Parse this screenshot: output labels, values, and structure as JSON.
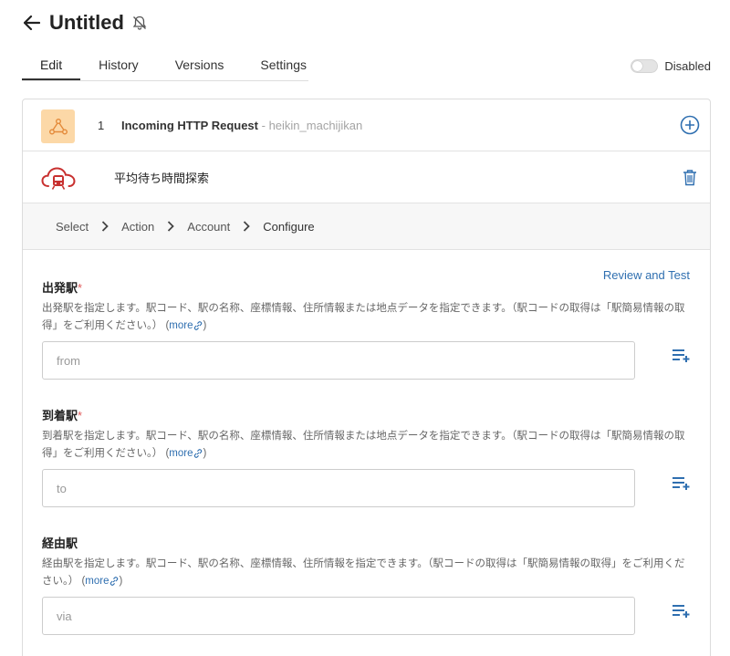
{
  "header": {
    "title": "Untitled"
  },
  "tabs": [
    {
      "label": "Edit",
      "active": true
    },
    {
      "label": "History"
    },
    {
      "label": "Versions"
    },
    {
      "label": "Settings"
    }
  ],
  "toggle": {
    "label": "Disabled",
    "enabled": false
  },
  "step": {
    "number": "1",
    "title": "Incoming HTTP Request",
    "subtitle": "- heikin_machijikan"
  },
  "service": {
    "title": "平均待ち時間探索"
  },
  "breadcrumb": {
    "items": [
      "Select",
      "Action",
      "Account",
      "Configure"
    ]
  },
  "form": {
    "review_label": "Review and Test",
    "more_label": "more",
    "fields": [
      {
        "label": "出発駅",
        "required": "*",
        "description": "出発駅を指定します。駅コード、駅の名称、座標情報、住所情報または地点データを指定できます。（駅コードの取得は「駅簡易情報の取得」をご利用ください。）",
        "placeholder": "from"
      },
      {
        "label": "到着駅",
        "required": "*",
        "description": "到着駅を指定します。駅コード、駅の名称、座標情報、住所情報または地点データを指定できます。（駅コードの取得は「駅簡易情報の取得」をご利用ください。）",
        "placeholder": "to"
      },
      {
        "label": "経由駅",
        "required": "",
        "description": "経由駅を指定します。駅コード、駅の名称、座標情報、住所情報を指定できます。（駅コードの取得は「駅簡易情報の取得」をご利用ください。）",
        "placeholder": "via"
      }
    ]
  },
  "colors": {
    "accent": "#2f6fb0",
    "step_icon_bg": "#fcd8a7",
    "logo_red": "#c8302f"
  }
}
